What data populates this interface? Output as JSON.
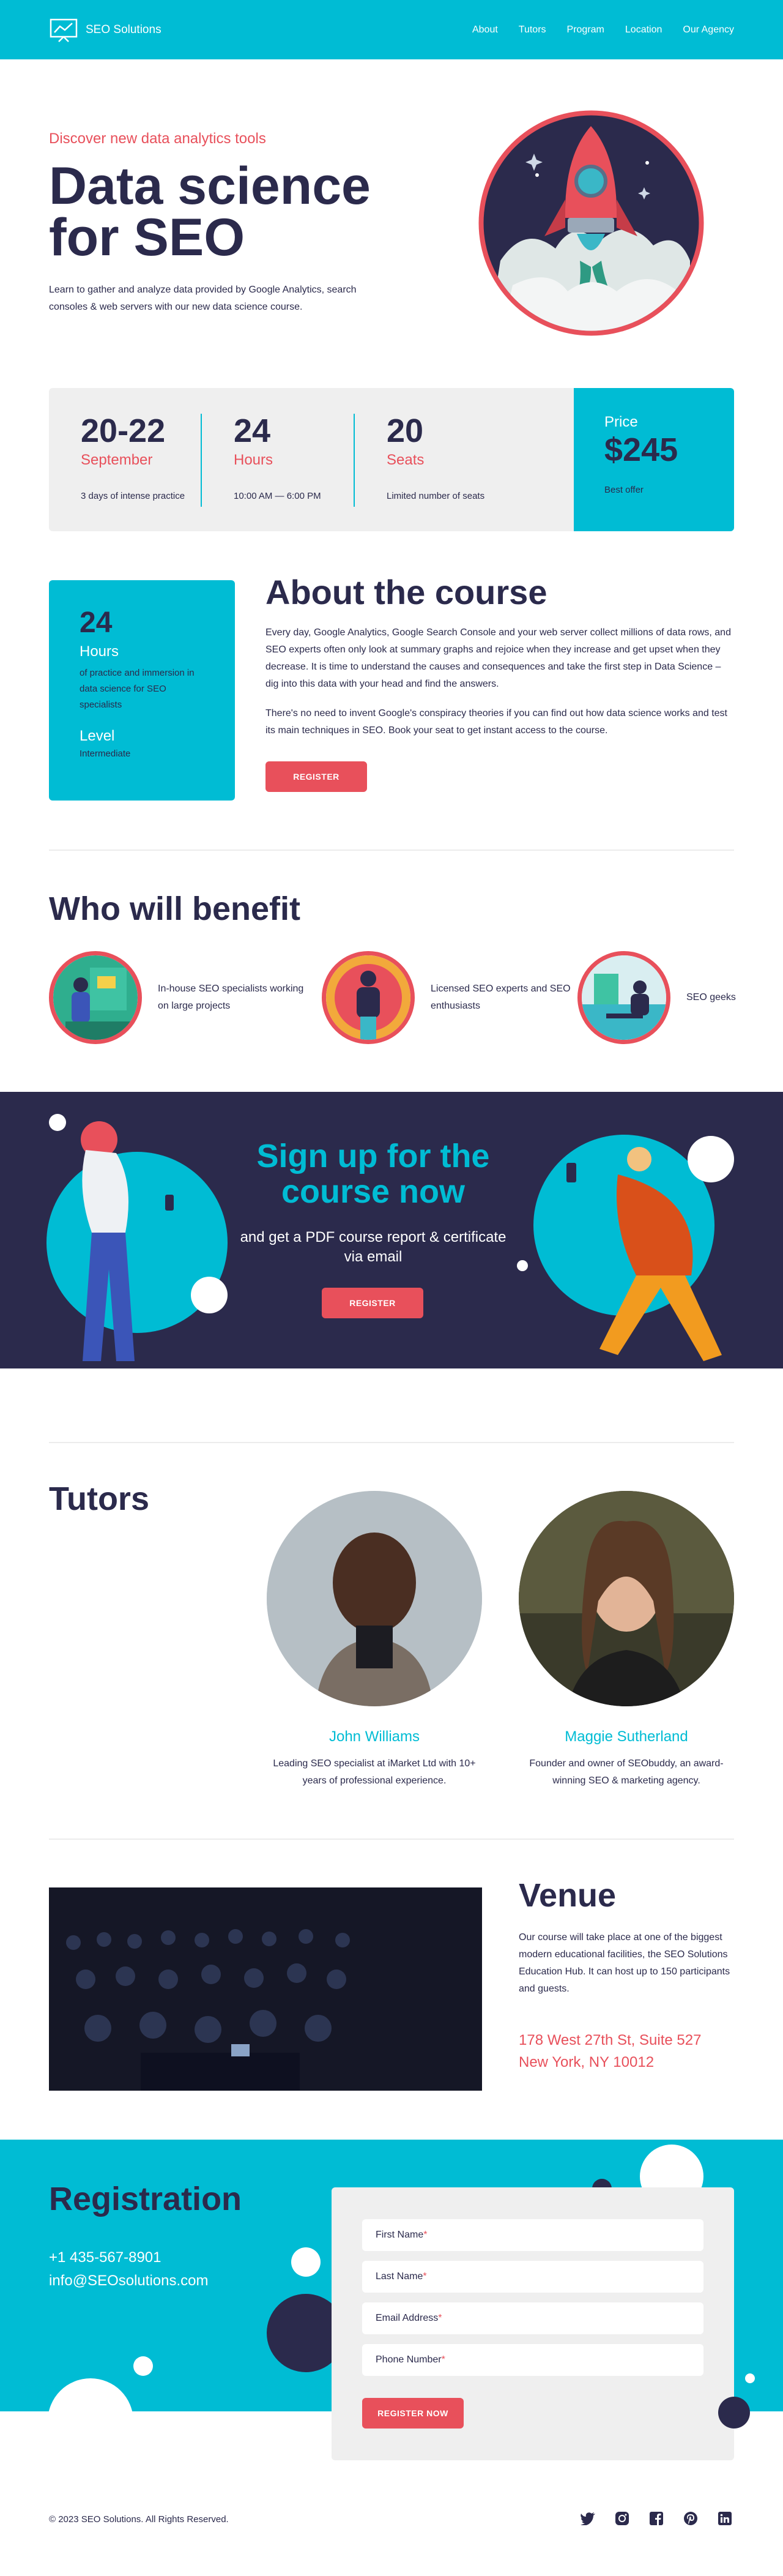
{
  "header": {
    "logo_text": "SEO Solutions",
    "nav": [
      "About",
      "Tutors",
      "Program",
      "Location",
      "Our Agency"
    ]
  },
  "hero": {
    "kicker": "Discover new data analytics tools",
    "title": "Data science for SEO",
    "lead": "Learn to gather and analyze data provided by Google Analytics, search consoles & web servers with our new data science course."
  },
  "stats": [
    {
      "big": "20-22",
      "unit": "September",
      "desc": "3 days of intense practice"
    },
    {
      "big": "24",
      "unit": "Hours",
      "desc": "10:00 AM — 6:00 PM"
    },
    {
      "big": "20",
      "unit": "Seats",
      "desc": "Limited number of seats"
    }
  ],
  "price": {
    "label": "Price",
    "value": "$245",
    "note": "Best offer"
  },
  "about": {
    "card_number": "24",
    "card_hours": "Hours",
    "card_text": "of practice and immersion in data science for SEO specialists",
    "card_level_label": "Level",
    "card_level_value": "Intermediate",
    "title": "About the course",
    "p1": "Every day, Google Analytics, Google Search Console and your web server collect millions of data rows, and SEO experts often only look at summary graphs and rejoice when they increase and get upset when they decrease. It is time to understand the causes and consequences and take the first step in Data Science – dig into this data with your head and find the answers.",
    "p2": "There's no need to invent Google's conspiracy theories if you can find out how data science works and test its main techniques in SEO. Book your seat to get instant access to the course.",
    "button": "REGISTER"
  },
  "benefit": {
    "title": "Who will benefit",
    "items": [
      {
        "label": "In-house SEO specialists working on large projects"
      },
      {
        "label": "Licensed SEO experts and SEO enthusiasts"
      },
      {
        "label": "SEO geeks"
      }
    ]
  },
  "signup": {
    "title": "Sign up for the course now",
    "text": "and get a PDF course report & certificate via email",
    "button": "REGISTER"
  },
  "tutors": {
    "title": "Tutors",
    "list": [
      {
        "name": "John Williams",
        "desc": "Leading SEO specialist at iMarket Ltd with 10+ years of professional experience."
      },
      {
        "name": "Maggie Sutherland",
        "desc": "Founder and owner of SEObuddy, an award-winning SEO & marketing agency."
      }
    ]
  },
  "venue": {
    "title": "Venue",
    "text": "Our course will take place at one of the biggest modern educational facilities, the SEO Solutions Education Hub. It can host up to 150 participants and guests.",
    "addr1": "178 West 27th St, Suite 527",
    "addr2": "New York, NY 10012"
  },
  "registration": {
    "title": "Registration",
    "phone": "+1 435-567-8901",
    "email": "info@SEOsolutions.com",
    "fields": [
      "First Name",
      "Last Name",
      "Email Address",
      "Phone Number"
    ],
    "button": "REGISTER NOW"
  },
  "footer": {
    "copy": "© 2023 SEO Solutions. All Rights Reserved.",
    "socials": [
      "twitter-icon",
      "instagram-icon",
      "facebook-icon",
      "pinterest-icon",
      "linkedin-icon"
    ]
  },
  "colors": {
    "cyan": "#00bcd4",
    "navy": "#2b2a4c",
    "red": "#e8505b",
    "grey": "#efefef"
  }
}
